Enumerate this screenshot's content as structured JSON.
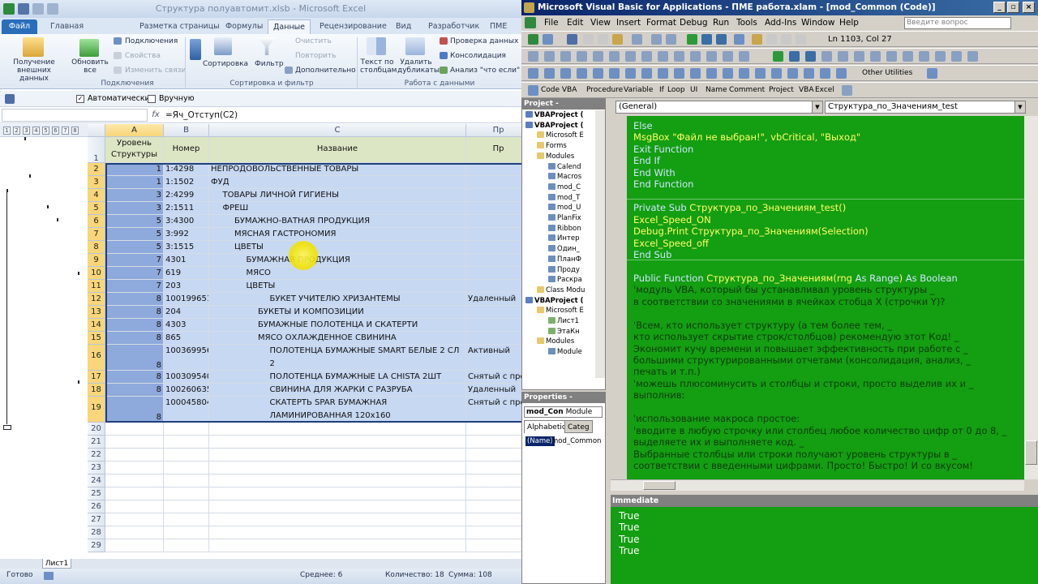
{
  "excel": {
    "title": "Структура полуавтомит.xlsb - Microsoft Excel",
    "tabs": [
      "Файл",
      "Главная",
      "Разметка страницы",
      "Формулы",
      "Данные",
      "Рецензирование",
      "Вид",
      "Разработчик",
      "ПМЕ"
    ],
    "active_tab": "Данные",
    "ribbon": {
      "get_external": "Получение внешних данных",
      "refresh_all": "Обновить все",
      "connections": "Подключения",
      "properties": "Свойства",
      "edit_links": "Изменить связи",
      "group_connections": "Подключения",
      "sort": "Сортировка",
      "filter": "Фильтр",
      "clear": "Очистить",
      "reapply": "Повторить",
      "advanced": "Дополнительно",
      "group_sort": "Сортировка и фильтр",
      "text_to_cols": "Текст по столбцам",
      "remove_dup": "Удалить дубликаты",
      "data_validation": "Проверка данных",
      "consolidate": "Консолидация",
      "what_if": "Анализ \"что если\"",
      "group_data": "Работа с данными"
    },
    "calc_auto": "Автоматически",
    "calc_manual": "Вручную",
    "formula": "=Яч_Отступ(C2)",
    "fx": "fx",
    "outline_levels": [
      "1",
      "2",
      "3",
      "4",
      "5",
      "6",
      "7",
      "8"
    ],
    "columns": [
      "A",
      "B",
      "C",
      "Пр"
    ],
    "header_row": {
      "a": "Уровень Структуры",
      "b": "Номер",
      "c": "Название",
      "d": "Пр"
    },
    "rows": [
      {
        "n": "2",
        "a": "1",
        "b": "1:4298",
        "c": "НЕПРОДОВОЛЬСТВЕННЫЕ ТОВАРЫ",
        "d": "",
        "ind": 0
      },
      {
        "n": "3",
        "a": "1",
        "b": "1:1502",
        "c": "ФУД",
        "d": "",
        "ind": 0
      },
      {
        "n": "4",
        "a": "3",
        "b": "2:4299",
        "c": "ТОВАРЫ ЛИЧНОЙ ГИГИЕНЫ",
        "d": "",
        "ind": 1
      },
      {
        "n": "5",
        "a": "3",
        "b": "2:1511",
        "c": "ФРЕШ",
        "d": "",
        "ind": 1
      },
      {
        "n": "6",
        "a": "5",
        "b": "3:4300",
        "c": "БУМАЖНО-ВАТНАЯ ПРОДУКЦИЯ",
        "d": "",
        "ind": 2
      },
      {
        "n": "7",
        "a": "5",
        "b": "3:992",
        "c": "МЯСНАЯ ГАСТРОНОМИЯ",
        "d": "",
        "ind": 2
      },
      {
        "n": "8",
        "a": "5",
        "b": "3:1515",
        "c": "ЦВЕТЫ",
        "d": "",
        "ind": 2
      },
      {
        "n": "9",
        "a": "7",
        "b": "4301",
        "c": "БУМАЖНАЯ ПРОДУКЦИЯ",
        "d": "",
        "ind": 3
      },
      {
        "n": "10",
        "a": "7",
        "b": "619",
        "c": "МЯСО",
        "d": "",
        "ind": 3
      },
      {
        "n": "11",
        "a": "7",
        "b": "203",
        "c": "ЦВЕТЫ",
        "d": "",
        "ind": 3
      },
      {
        "n": "12",
        "a": "8",
        "b": "100199651",
        "c": "БУКЕТ УЧИТЕЛЮ ХРИЗАНТЕМЫ",
        "d": "Удаленный",
        "ind": 5
      },
      {
        "n": "13",
        "a": "8",
        "b": "204",
        "c": "БУКЕТЫ И КОМПОЗИЦИИ",
        "d": "",
        "ind": 4
      },
      {
        "n": "14",
        "a": "8",
        "b": "4303",
        "c": "БУМАЖНЫЕ ПОЛОТЕНЦА И СКАТЕРТИ",
        "d": "",
        "ind": 4
      },
      {
        "n": "15",
        "a": "8",
        "b": "865",
        "c": "МЯСО ОХЛАЖДЕННОЕ СВИНИНА",
        "d": "",
        "ind": 4
      },
      {
        "n": "16",
        "a": "8",
        "b": "100369956",
        "c": "ПОЛОТЕНЦА БУМАЖНЫЕ SMART БЕЛЫЕ 2 СЛ 2",
        "c2": "РУЛ",
        "d": "Активный",
        "ind": 5,
        "tall": true
      },
      {
        "n": "17",
        "a": "8",
        "b": "100309540",
        "c": "ПОЛОТЕНЦА БУМАЖНЫЕ  LA CHISTA 2ШТ",
        "d": "Снятый с про",
        "ind": 5
      },
      {
        "n": "18",
        "a": "8",
        "b": "100260635",
        "c": "СВИНИНА ДЛЯ ЖАРКИ С РАЗРУБА",
        "d": "Удаленный",
        "ind": 5
      },
      {
        "n": "19",
        "a": "8",
        "b": "100045804",
        "c": "СКАТЕРТЬ SPAR БУМАЖНАЯ",
        "c2": "ЛАМИНИРОВАННАЯ 120х160",
        "d": "Снятый с про",
        "ind": 5,
        "tall": true
      }
    ],
    "empty_rows": [
      "20",
      "21",
      "22",
      "23",
      "24",
      "25",
      "26",
      "27",
      "28",
      "29"
    ],
    "sheet_tab": "Лист1",
    "status": {
      "ready": "Готово",
      "avg": "Среднее: 6",
      "count": "Количество: 18",
      "sum": "Сумма: 108"
    }
  },
  "vba": {
    "title": "Microsoft Visual Basic for Applications - ПМЕ работа.xlam - [mod_Common (Code)]",
    "menus": [
      "File",
      "Edit",
      "View",
      "Insert",
      "Format",
      "Debug",
      "Run",
      "Tools",
      "Add-Ins",
      "Window",
      "Help"
    ],
    "help_placeholder": "Введите вопрос",
    "lncol": "Ln 1103, Col 27",
    "other_utilities": "Other Utilities",
    "toolbar4": [
      "Code VBA",
      "Procedure",
      "Variable",
      "If",
      "Loop",
      "UI",
      "Name",
      "Comment",
      "Project",
      "VBA",
      "Excel"
    ],
    "project_title": "Project - VBAProject",
    "tree": [
      {
        "t": "VBAProject (",
        "b": true,
        "lv": 0,
        "c": "#5b7fbf"
      },
      {
        "t": "VBAProject (",
        "b": true,
        "lv": 0,
        "c": "#5b7fbf"
      },
      {
        "t": "Microsoft E",
        "b": false,
        "lv": 1,
        "c": "#e8c86a"
      },
      {
        "t": "Forms",
        "b": false,
        "lv": 1,
        "c": "#e8c86a"
      },
      {
        "t": "Modules",
        "b": false,
        "lv": 1,
        "c": "#e8c86a"
      },
      {
        "t": "Calend",
        "b": false,
        "lv": 2,
        "c": "#6c8fbf"
      },
      {
        "t": "Macros",
        "b": false,
        "lv": 2,
        "c": "#6c8fbf"
      },
      {
        "t": "mod_C",
        "b": false,
        "lv": 2,
        "c": "#6c8fbf"
      },
      {
        "t": "mod_T",
        "b": false,
        "lv": 2,
        "c": "#6c8fbf"
      },
      {
        "t": "mod_U",
        "b": false,
        "lv": 2,
        "c": "#6c8fbf"
      },
      {
        "t": "PlanFix",
        "b": false,
        "lv": 2,
        "c": "#6c8fbf"
      },
      {
        "t": "Ribbon",
        "b": false,
        "lv": 2,
        "c": "#6c8fbf"
      },
      {
        "t": "Интер",
        "b": false,
        "lv": 2,
        "c": "#6c8fbf"
      },
      {
        "t": "Один_",
        "b": false,
        "lv": 2,
        "c": "#6c8fbf"
      },
      {
        "t": "ПланФ",
        "b": false,
        "lv": 2,
        "c": "#6c8fbf"
      },
      {
        "t": "Проду",
        "b": false,
        "lv": 2,
        "c": "#6c8fbf"
      },
      {
        "t": "Раскра",
        "b": false,
        "lv": 2,
        "c": "#6c8fbf"
      },
      {
        "t": "Class Modu",
        "b": false,
        "lv": 1,
        "c": "#e8c86a"
      },
      {
        "t": "VBAProject (",
        "b": true,
        "lv": 0,
        "c": "#5b7fbf"
      },
      {
        "t": "Microsoft E",
        "b": false,
        "lv": 1,
        "c": "#e8c86a"
      },
      {
        "t": "Лист1",
        "b": false,
        "lv": 2,
        "c": "#7fb06a"
      },
      {
        "t": "ЭтаКн",
        "b": false,
        "lv": 2,
        "c": "#7fb06a"
      },
      {
        "t": "Modules",
        "b": false,
        "lv": 1,
        "c": "#e8c86a"
      },
      {
        "t": "Module",
        "b": false,
        "lv": 2,
        "c": "#6c8fbf"
      }
    ],
    "props_title": "Properties - mod_Co",
    "props_object": "mod_Con",
    "props_type": "Module",
    "props_tabs": [
      "Alphabetic",
      "Categ"
    ],
    "props_name_key": "(Name)",
    "props_name_val": "mod_Common",
    "combo_general": "(General)",
    "combo_proc": "Структура_по_Значениям_test",
    "immediate_title": "Immediate",
    "immediate_lines": [
      "True",
      "True",
      "True",
      "True"
    ]
  },
  "code_lines": [
    [
      [
        "kw",
        "        Else"
      ]
    ],
    [
      [
        "pl",
        "            MsgBox \"Файл не выбран!\", vbCritical, \"Выход\""
      ]
    ],
    [
      [
        "kw",
        "            Exit Function"
      ]
    ],
    [
      [
        "kw",
        "        End If"
      ]
    ],
    [
      [
        "kw",
        "    End With"
      ]
    ],
    [
      [
        "kw",
        "End Function"
      ]
    ],
    [
      [
        "pl",
        ""
      ]
    ],
    [
      [
        "kw",
        "Private Sub "
      ],
      [
        "pl",
        "Структура_по_Значениям_test()"
      ]
    ],
    [
      [
        "pl",
        "Excel_Speed_ON"
      ]
    ],
    [
      [
        "pl",
        "    Debug.Print Структура_по_Значениям(Selection)"
      ]
    ],
    [
      [
        "pl",
        "Excel_Speed_off"
      ]
    ],
    [
      [
        "kw",
        "End Sub"
      ]
    ],
    [
      [
        "pl",
        ""
      ]
    ],
    [
      [
        "kw",
        "Public Function "
      ],
      [
        "pl",
        "Структура_по_Значениям(rng "
      ],
      [
        "kw",
        "As Range"
      ],
      [
        "pl",
        ") "
      ],
      [
        "kw",
        "As Boolean"
      ]
    ],
    [
      [
        "cm",
        "'модуль VBA, который бы устанавливал уровень структуры _"
      ]
    ],
    [
      [
        "cm",
        "в соответствии со значениями в ячейках стобца X (строчки Y)?"
      ]
    ],
    [
      [
        "cm",
        ""
      ]
    ],
    [
      [
        "cm",
        "'Всем, кто использует структуру (а тем более тем, _"
      ]
    ],
    [
      [
        "cm",
        "кто использует скрытие строк/столбцов) рекомендую этот Код! _"
      ]
    ],
    [
      [
        "cm",
        "Экономит кучу времени и повышает эффективность при работе с _"
      ]
    ],
    [
      [
        "cm",
        "большими структурированными отчетами (консолидация, анализ, _"
      ]
    ],
    [
      [
        "cm",
        "печать и т.п.)"
      ]
    ],
    [
      [
        "cm",
        "'можешь плюсоминусить и столбцы и строки, просто выделив их и _"
      ]
    ],
    [
      [
        "cm",
        "выполнив:"
      ]
    ],
    [
      [
        "cm",
        ""
      ]
    ],
    [
      [
        "cm",
        "'использование макроса простое:"
      ]
    ],
    [
      [
        "cm",
        "'вводите в любую строчку или столбец любое количество цифр от 0 до 8, _"
      ]
    ],
    [
      [
        "cm",
        "выделяете их и выполняете код. _"
      ]
    ],
    [
      [
        "cm",
        "Выбранные столбцы или строки получают уровень структуры в _"
      ]
    ],
    [
      [
        "cm",
        "соответствии с введенными цифрами. Просто! Быстро! И со вкусом!"
      ]
    ]
  ]
}
